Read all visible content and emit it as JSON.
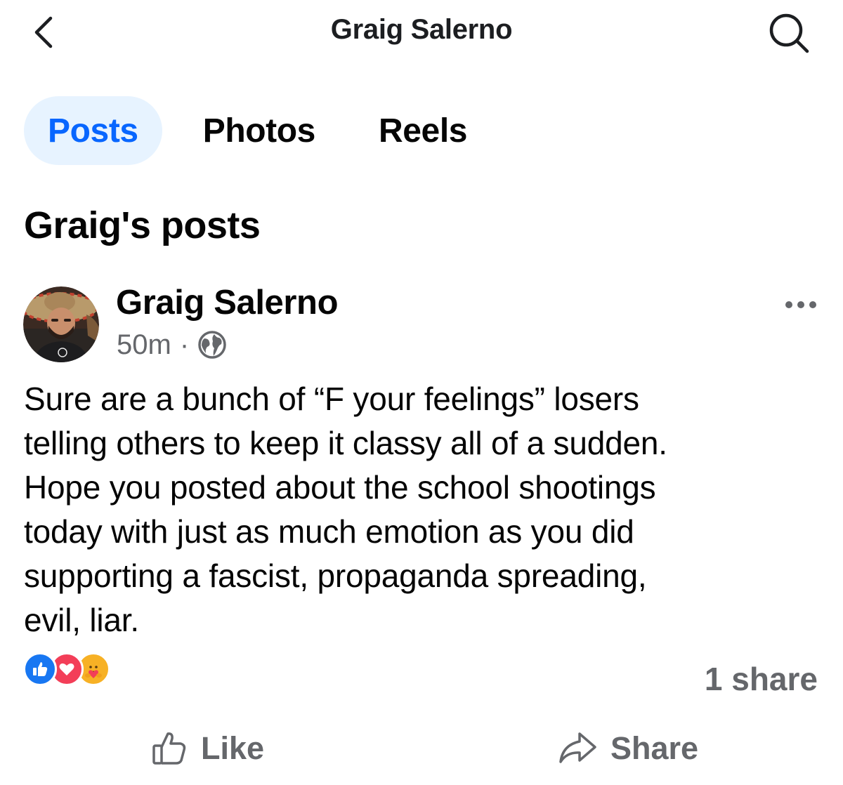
{
  "header": {
    "title": "Graig Salerno",
    "back_icon": "chevron-left-icon",
    "search_icon": "search-icon"
  },
  "tabs": [
    {
      "label": "Posts",
      "active": true
    },
    {
      "label": "Photos",
      "active": false
    },
    {
      "label": "Reels",
      "active": false
    }
  ],
  "section": {
    "title": "Graig's posts"
  },
  "post": {
    "author": "Graig Salerno",
    "time": "50m",
    "separator": "·",
    "privacy_icon": "globe-icon",
    "more_icon": "more-horizontal-icon",
    "text_lines": [
      "Sure are a bunch of “F your feelings” losers",
      "telling others to keep it classy all of a sudden.",
      "Hope you posted about the school shootings",
      "today with just as much emotion as you did",
      "supporting a fascist, propaganda spreading,",
      "evil, liar."
    ],
    "reactions": [
      "like-reaction-icon",
      "love-reaction-icon",
      "care-reaction-icon"
    ],
    "share_count": "1 share"
  },
  "actions": {
    "like_label": "Like",
    "share_label": "Share"
  },
  "colors": {
    "accent": "#0866ff",
    "tab_active_bg": "#e7f3ff",
    "secondary_text": "#65676b",
    "primary_text": "#050505",
    "love": "#f33e58",
    "care": "#f7b125"
  }
}
